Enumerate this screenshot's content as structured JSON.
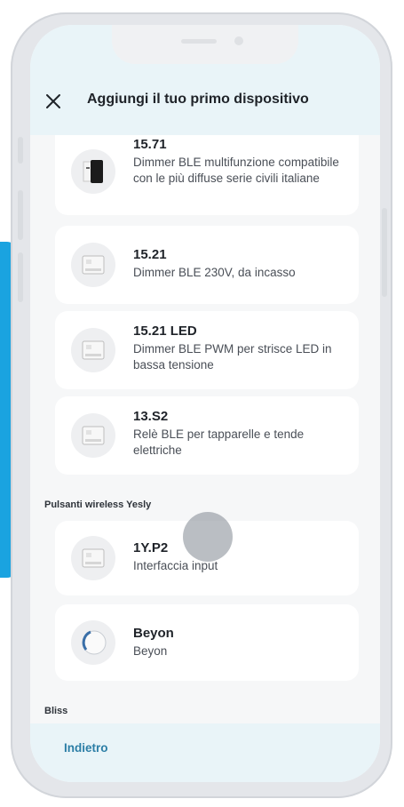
{
  "header": {
    "title": "Aggiungi il tuo primo dispositivo"
  },
  "devices": [
    {
      "title": "15.71",
      "desc": "Dimmer BLE multifunzione compatibile con le più diffuse serie civili italiane",
      "icon": "dimmer-box-icon"
    },
    {
      "title": "15.21",
      "desc": "Dimmer BLE 230V, da incasso",
      "icon": "module-icon"
    },
    {
      "title": "15.21 LED",
      "desc": "Dimmer BLE PWM per strisce LED in bassa tensione",
      "icon": "module-icon"
    },
    {
      "title": "13.S2",
      "desc": "Relè BLE per tapparelle e tende elettriche",
      "icon": "module-icon"
    }
  ],
  "sections": {
    "wireless": {
      "label": "Pulsanti wireless Yesly",
      "devices": [
        {
          "title": "1Y.P2",
          "desc": "Interfaccia input",
          "icon": "module-icon"
        },
        {
          "title": "Beyon",
          "desc": "Beyon",
          "icon": "round-button-icon"
        }
      ]
    },
    "bliss": {
      "label": "Bliss"
    }
  },
  "footer": {
    "back_label": "Indietro"
  },
  "colors": {
    "header_bg": "#e9f4f8",
    "accent": "#2c7ea6",
    "side_strip": "#1aa3e0"
  }
}
